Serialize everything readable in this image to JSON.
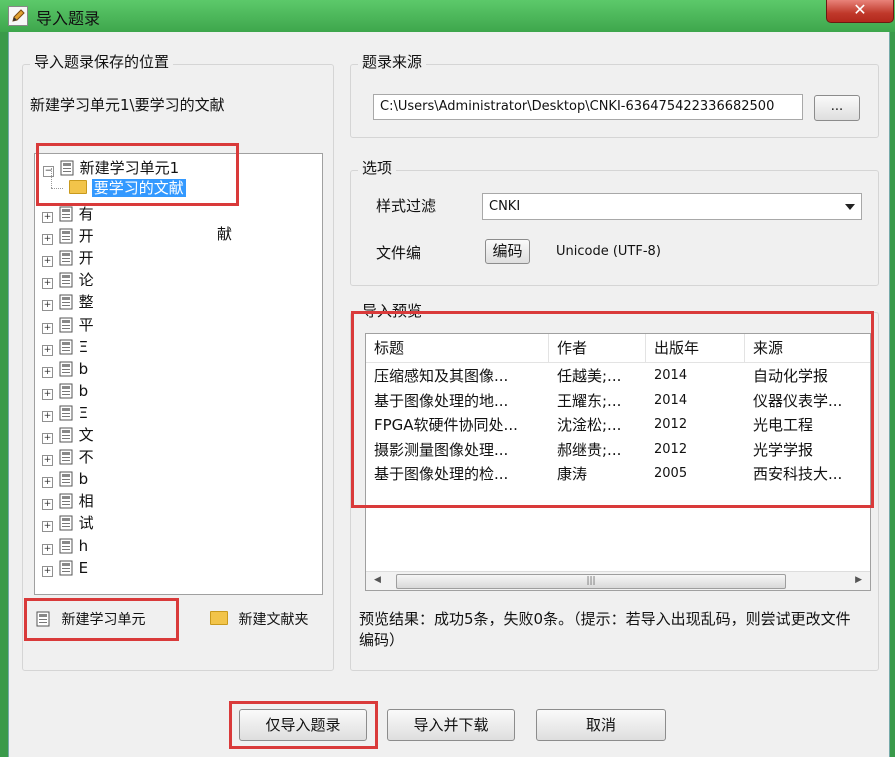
{
  "window": {
    "title": "导入题录",
    "close": "✕"
  },
  "save_location": {
    "group_title": "导入题录保存的位置",
    "path": "新建学习单元1\\要学习的文献",
    "tree": {
      "root": "新建学习单元1",
      "selected_child": "要学习的文献",
      "others": [
        "有",
        "开",
        "开",
        "论",
        "整",
        "平",
        "Ξ",
        "b",
        "b",
        "Ξ",
        "文",
        "不",
        "b",
        "相",
        "试",
        "h",
        "E"
      ],
      "stray_text": "献"
    },
    "buttons": {
      "new_unit": "新建学习单元",
      "new_folder": "新建文献夹"
    }
  },
  "source": {
    "group_title": "题录来源",
    "path_value": "C:\\Users\\Administrator\\Desktop\\CNKI-636475422336682500",
    "browse": "..."
  },
  "options": {
    "group_title": "选项",
    "style_filter_label": "样式过滤",
    "style_filter_value": "CNKI",
    "encoding_label": "文件编",
    "encoding_button": "编码",
    "encoding_value": "Unicode (UTF-8)"
  },
  "preview": {
    "group_title": "导入预览",
    "columns": [
      "标题",
      "作者",
      "出版年",
      "来源"
    ],
    "rows": [
      [
        "压缩感知及其图像...",
        "任越美;...",
        "2014",
        "自动化学报"
      ],
      [
        "基于图像处理的地...",
        "王耀东;...",
        "2014",
        "仪器仪表学..."
      ],
      [
        "FPGA软硬件协同处...",
        "沈淦松;...",
        "2012",
        "光电工程"
      ],
      [
        "摄影测量图像处理...",
        "郝继贵;...",
        "2012",
        "光学学报"
      ],
      [
        "基于图像处理的检...",
        "康涛",
        "2005",
        "西安科技大..."
      ]
    ],
    "scroll_grip": "|||",
    "result_text": "预览结果：成功5条，失败0条。（提示：若导入出现乱码，则尝试更改文件编码）"
  },
  "footer": {
    "import_only": "仅导入题录",
    "import_download": "导入并下载",
    "cancel": "取消"
  }
}
